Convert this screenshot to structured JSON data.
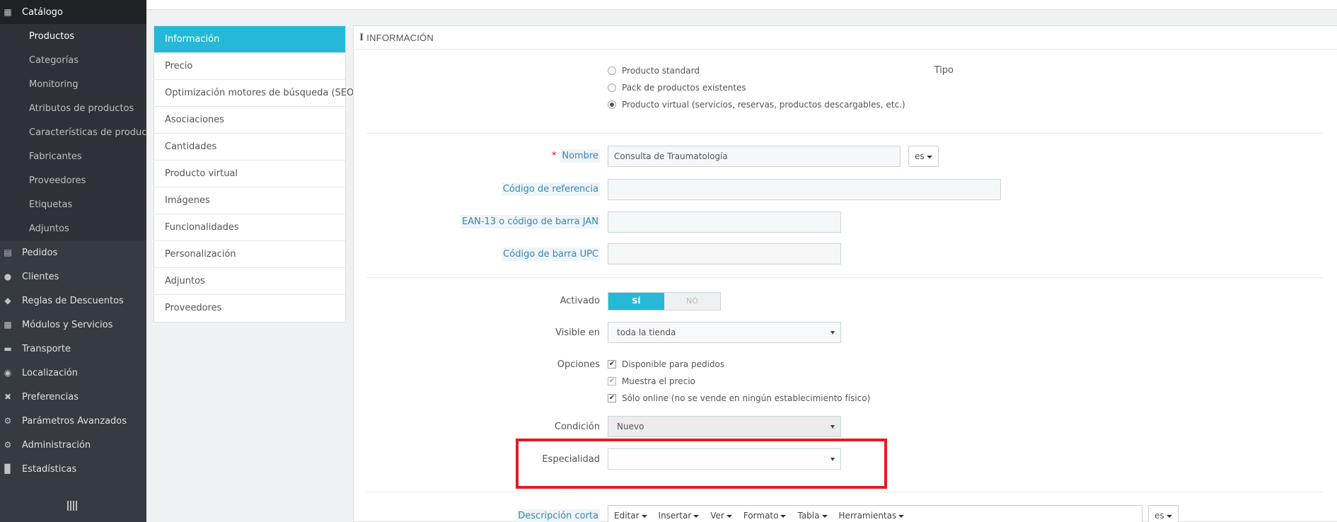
{
  "sidebar": {
    "catalog": "Catálogo",
    "sub_items": [
      "Productos",
      "Categorías",
      "Monitoring",
      "Atributos de productos",
      "Características de product...",
      "Fabricantes",
      "Proveedores",
      "Etiquetas",
      "Adjuntos"
    ],
    "sections": [
      {
        "label": "Pedidos",
        "icon": "credit-card-icon"
      },
      {
        "label": "Clientes",
        "icon": "users-icon"
      },
      {
        "label": "Reglas de Descuentos",
        "icon": "tags-icon"
      },
      {
        "label": "Módulos y Servicios",
        "icon": "puzzle-icon"
      },
      {
        "label": "Transporte",
        "icon": "truck-icon"
      },
      {
        "label": "Localización",
        "icon": "globe-icon"
      },
      {
        "label": "Preferencias",
        "icon": "wrench-icon"
      },
      {
        "label": "Parámetros Avanzados",
        "icon": "cogs-icon"
      },
      {
        "label": "Administración",
        "icon": "gear-icon"
      },
      {
        "label": "Estadísticas",
        "icon": "bar-chart-icon"
      }
    ]
  },
  "tabs": [
    "Información",
    "Precio",
    "Optimización motores de búsqueda (SEO)",
    "Asociaciones",
    "Cantidades",
    "Producto virtual",
    "Imágenes",
    "Funcionalidades",
    "Personalización",
    "Adjuntos",
    "Proveedores"
  ],
  "panel": {
    "heading": "INFORMACIÓN",
    "tipo_label": "Tipo",
    "tipo_options": [
      "Producto standard",
      "Pack de productos existentes",
      "Producto virtual (servicios, reservas, productos descargables, etc.)"
    ],
    "tipo_selected_index": 2,
    "required_mark": "*",
    "nombre_label": "Nombre",
    "nombre_value": "Consulta de Traumatología",
    "lang": "es",
    "referencia_label": "Código de referencia",
    "referencia_value": "",
    "ean_label": "EAN-13 o código de barra JAN",
    "ean_value": "",
    "upc_label": "Código de barra UPC",
    "upc_value": "",
    "activado_label": "Activado",
    "switch_on": "SÍ",
    "switch_off": "NO",
    "visible_label": "Visible en",
    "visible_value": "toda la tienda",
    "opciones_label": "Opciones",
    "opciones": [
      "Disponible para pedidos",
      "Muestra el precio",
      "Sólo online (no se vende en ningún establecimiento físico)"
    ],
    "condicion_label": "Condición",
    "condicion_value": "Nuevo",
    "especialidad_label": "Especialidad",
    "especialidad_value": "",
    "desc_label": "Descripción corta",
    "editor_menu": [
      "Editar",
      "Insertar",
      "Ver",
      "Formato",
      "Tabla",
      "Herramientas"
    ]
  }
}
